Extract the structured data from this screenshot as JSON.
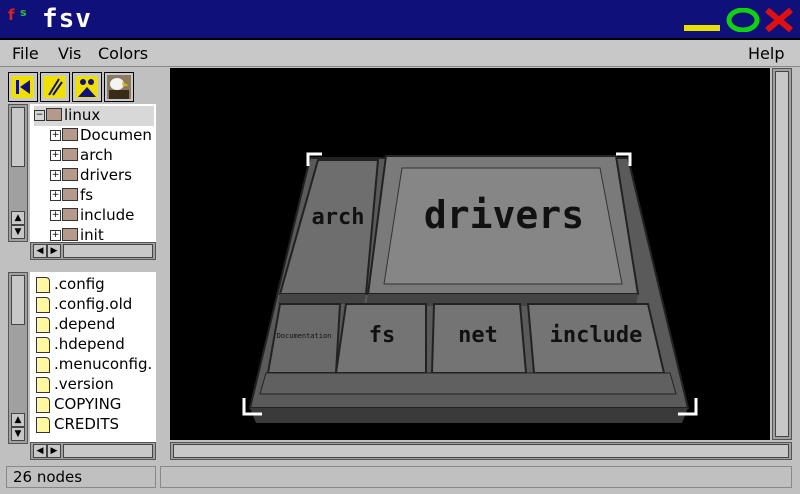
{
  "window": {
    "title": "fsv"
  },
  "menus": [
    "File",
    "Vis",
    "Colors",
    "Help"
  ],
  "tree": {
    "root": "linux",
    "items": [
      "Documen",
      "arch",
      "drivers",
      "fs",
      "include",
      "init"
    ]
  },
  "files": [
    ".config",
    ".config.old",
    ".depend",
    ".hdepend",
    ".menuconfig.",
    ".version",
    "COPYING",
    "CREDITS"
  ],
  "status": {
    "text": "26 nodes"
  },
  "view3d": {
    "blocks": [
      "arch",
      "drivers",
      "Documentation",
      "fs",
      "net",
      "include"
    ]
  }
}
